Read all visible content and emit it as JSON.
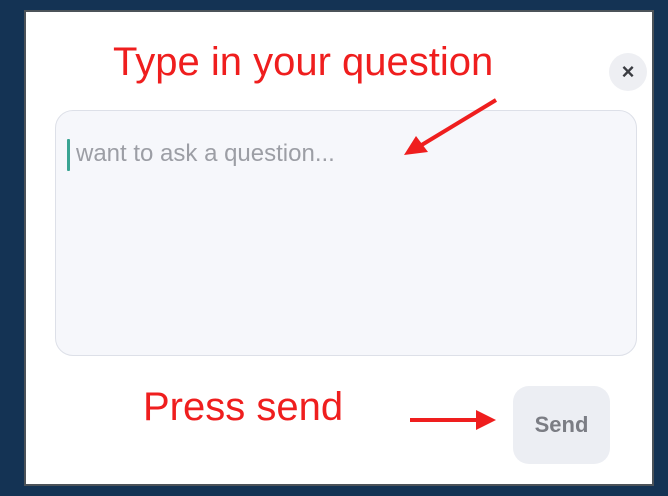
{
  "dialog": {
    "close_label": "×",
    "input": {
      "placeholder": "want to ask a question..."
    },
    "send_label": "Send"
  },
  "annotations": {
    "question_hint": "Type in your question",
    "send_hint": "Press send",
    "color": "#ef1e1e"
  },
  "icons": {
    "close": "close-icon",
    "arrow": "arrow-icon"
  },
  "colors": {
    "backdrop": "#143354",
    "dialog_bg": "#ffffff",
    "input_bg": "#f6f7fb",
    "caret": "#3aa493",
    "send_bg": "#eceef3"
  }
}
